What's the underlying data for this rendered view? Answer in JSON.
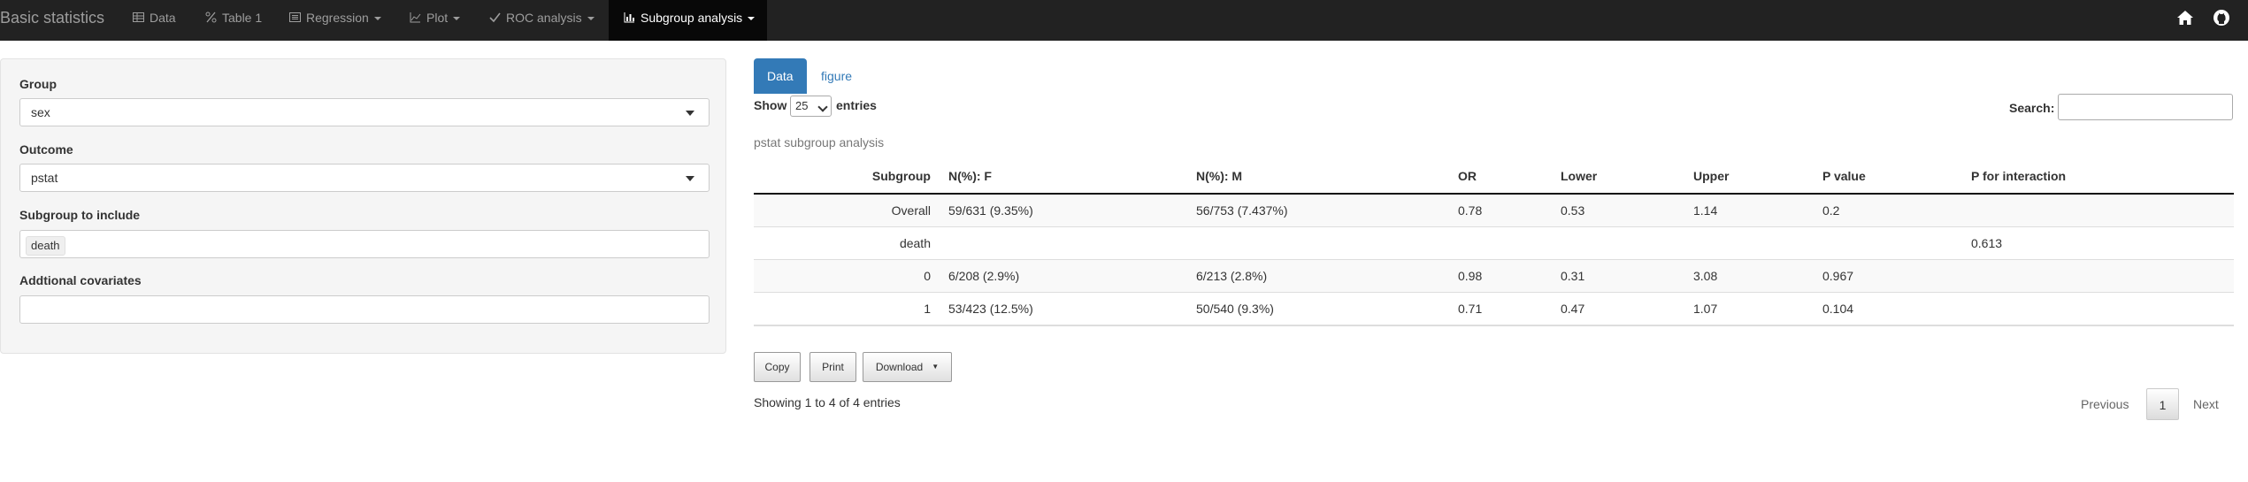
{
  "navbar": {
    "brand": "Basic statistics",
    "items": [
      {
        "label": "Data",
        "icon": "table-icon",
        "dropdown": false
      },
      {
        "label": "Table 1",
        "icon": "percent-icon",
        "dropdown": false
      },
      {
        "label": "Regression",
        "icon": "list-alt-icon",
        "dropdown": true
      },
      {
        "label": "Plot",
        "icon": "line-chart-icon",
        "dropdown": true
      },
      {
        "label": "ROC analysis",
        "icon": "check-icon",
        "dropdown": true
      },
      {
        "label": "Subgroup analysis",
        "icon": "bar-chart-icon",
        "dropdown": true,
        "active": true
      }
    ],
    "right_icons": [
      "home-icon",
      "github-icon"
    ],
    "colors": {
      "background": "#222222",
      "active": "#080808",
      "text": "#9d9d9d"
    }
  },
  "sidebar": {
    "group_label": "Group",
    "group_value": "sex",
    "outcome_label": "Outcome",
    "outcome_value": "pstat",
    "subgroup_label": "Subgroup to include",
    "subgroup_chips": [
      "death"
    ],
    "covariates_label": "Addtional covariates",
    "covariates_value": ""
  },
  "main": {
    "tabs": [
      {
        "label": "Data",
        "active": true
      },
      {
        "label": "figure",
        "active": false
      }
    ],
    "show_label": "Show",
    "length_value": "25",
    "entries_label": "entries",
    "search_label": "Search:",
    "search_value": "",
    "caption": "pstat subgroup analysis",
    "table": {
      "headers": [
        "Subgroup",
        "N(%): F",
        "N(%): M",
        "OR",
        "Lower",
        "Upper",
        "P value",
        "P for interaction"
      ],
      "rows": [
        [
          "Overall",
          "59/631 (9.35%)",
          "56/753 (7.437%)",
          "0.78",
          "0.53",
          "1.14",
          "0.2",
          ""
        ],
        [
          "death",
          "",
          "",
          "",
          "",
          "",
          "",
          "0.613"
        ],
        [
          "0",
          "6/208 (2.9%)",
          "6/213 (2.8%)",
          "0.98",
          "0.31",
          "3.08",
          "0.967",
          ""
        ],
        [
          "1",
          "53/423 (12.5%)",
          "50/540 (9.3%)",
          "0.71",
          "0.47",
          "1.07",
          "0.104",
          ""
        ]
      ]
    },
    "buttons": {
      "copy": "Copy",
      "print": "Print",
      "download": "Download"
    },
    "info": "Showing 1 to 4 of 4 entries",
    "pagination": {
      "previous": "Previous",
      "current": "1",
      "next": "Next"
    },
    "accent_color": "#337ab7"
  }
}
